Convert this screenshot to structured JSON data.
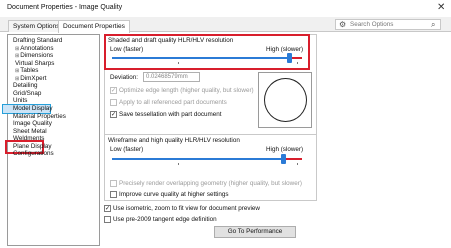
{
  "window": {
    "title": "Document Properties - Image Quality",
    "close_glyph": "✕"
  },
  "tabs": [
    "System Options",
    "Document Properties"
  ],
  "search": {
    "placeholder": "Search Options",
    "gear_glyph": "⚙",
    "mag_glyph": "⌕"
  },
  "tree": {
    "items": [
      {
        "label": "Drafting Standard",
        "expander": ""
      },
      {
        "label": "Annotations",
        "expander": "⊞"
      },
      {
        "label": "Dimensions",
        "expander": "⊞"
      },
      {
        "label": "Virtual Sharps",
        "expander": ""
      },
      {
        "label": "Tables",
        "expander": "⊞"
      },
      {
        "label": "DimXpert",
        "expander": "⊞"
      },
      {
        "label": "Detailing",
        "expander": ""
      },
      {
        "label": "Grid/Snap",
        "expander": ""
      },
      {
        "label": "Units",
        "expander": ""
      },
      {
        "label": "Model Display",
        "expander": ""
      },
      {
        "label": "Material Properties",
        "expander": ""
      },
      {
        "label": "Image Quality",
        "expander": ""
      },
      {
        "label": "Sheet Metal",
        "expander": ""
      },
      {
        "label": "Weldments",
        "expander": ""
      },
      {
        "label": "Plane Display",
        "expander": ""
      },
      {
        "label": "Configurations",
        "expander": ""
      }
    ],
    "selected_index": 11
  },
  "shaded": {
    "title": "Shaded and draft quality HLR/HLV resolution",
    "low_label": "Low (faster)",
    "high_label": "High (slower)",
    "slider_level": 0.93,
    "deviation_label": "Deviation:",
    "deviation_value": "0.02468579mm",
    "optimize_label": "Optimize edge length (higher quality, but slower)",
    "apply_label": "Apply to all referenced part documents",
    "save_tess_label": "Save tessellation with part document"
  },
  "wireframe": {
    "title": "Wireframe and high quality HLR/HLV resolution",
    "low_label": "Low (faster)",
    "high_label": "High (slower)",
    "slider_level": 0.9,
    "precisely_label": "Precisely render overlapping geometry (higher quality, but slower)",
    "improve_label": "Improve curve quality at higher settings"
  },
  "bottom": {
    "isometric_label": "Use isometric, zoom to fit view for document preview",
    "pre2009_label": "Use pre-2009 tangent edge definition",
    "performance_button": "Go To Performance"
  },
  "checked_glyph": "✓",
  "colors": {
    "accent": "#2b7bd6",
    "highlight_red": "#d81e2c",
    "selection": "#cce4f7"
  }
}
